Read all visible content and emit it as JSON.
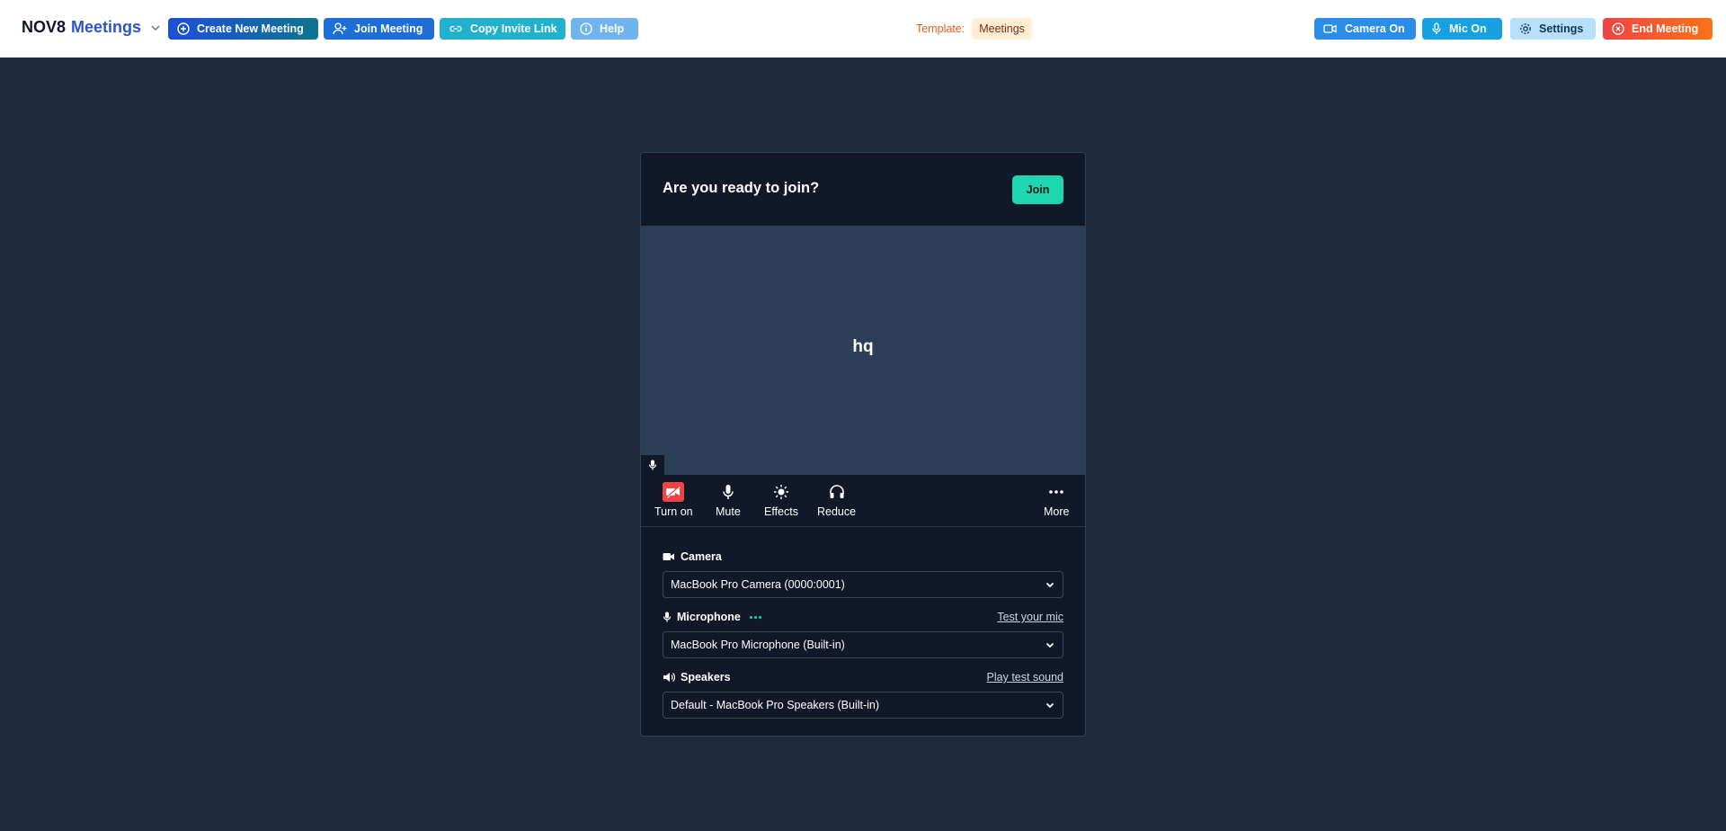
{
  "app": {
    "brand_main": "NOV8",
    "brand_sub": "Meetings"
  },
  "toolbar": {
    "create_label": "Create New Meeting",
    "join_label": "Join Meeting",
    "copy_label": "Copy Invite Link",
    "help_label": "Help",
    "template_label": "Template:",
    "template_value": "Meetings",
    "camera_label": "Camera On",
    "mic_label": "Mic On",
    "settings_label": "Settings",
    "end_label": "End Meeting"
  },
  "prejoin": {
    "title": "Are you ready to join?",
    "join_label": "Join",
    "participant_initials": "hq",
    "controls": {
      "camera": "Turn on",
      "mute": "Mute",
      "effects": "Effects",
      "reduce": "Reduce",
      "more": "More"
    },
    "devices": {
      "camera_label": "Camera",
      "camera_value": "MacBook Pro Camera (0000:0001)",
      "microphone_label": "Microphone",
      "microphone_value": "MacBook Pro Microphone (Built-in)",
      "mic_test_link": "Test your mic",
      "speakers_label": "Speakers",
      "speakers_value": "Default - MacBook Pro Speakers (Built-in)",
      "speakers_test_link": "Play test sound"
    }
  },
  "colors": {
    "background": "#1e293b",
    "accent": "#1ed6b0",
    "card": "#111827",
    "preview": "#2d3e57",
    "danger": "#ef4444"
  }
}
